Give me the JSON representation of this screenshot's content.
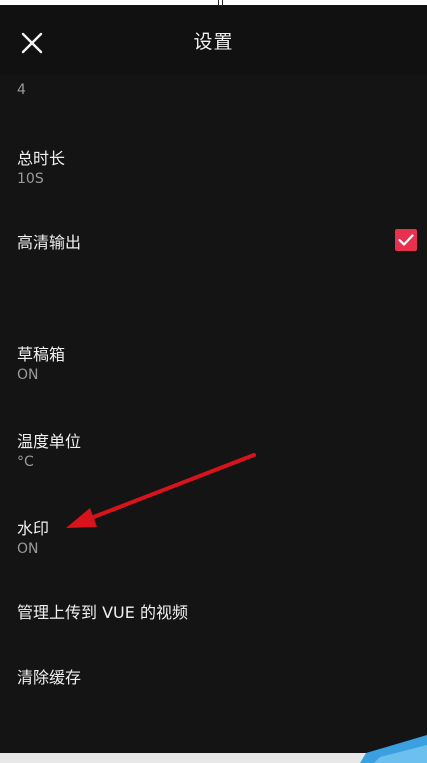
{
  "header": {
    "title": "设置",
    "close_icon": "close-icon"
  },
  "items": [
    {
      "title": "",
      "value": "4"
    },
    {
      "title": "总时长",
      "value": "10S"
    },
    {
      "title": "高清输出",
      "value": "",
      "checked": true
    },
    {
      "title": "草稿箱",
      "value": "ON"
    },
    {
      "title": "温度单位",
      "value": "°C"
    },
    {
      "title": "水印",
      "value": "ON"
    },
    {
      "title": "管理上传到 VUE 的视频",
      "value": ""
    },
    {
      "title": "清除缓存",
      "value": ""
    }
  ],
  "colors": {
    "background": "#141414",
    "header": "#111111",
    "accent": "#e8314e",
    "annotation_arrow": "#d8131b"
  }
}
